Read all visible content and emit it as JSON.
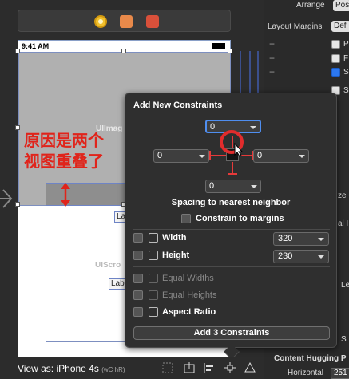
{
  "phone": {
    "status_time": "9:41 AM",
    "image_view_label": "UIImag",
    "scroll_view_label": "UIScro",
    "label1": "Lab",
    "label2": "Lab"
  },
  "annotation": {
    "line1": "原因是两个",
    "line2": "视图重叠了"
  },
  "inspector": {
    "arrange_label": "Arrange",
    "arrange_value": "Pos",
    "layout_margins_label": "Layout Margins",
    "layout_margins_value": "Def",
    "row_p": "P",
    "row_f": "F",
    "row_s": "S",
    "row_s2": "S",
    "side_ze": "ze C",
    "side_al": "al H",
    "side_le": "Le",
    "side_s": "S"
  },
  "popover": {
    "title": "Add New Constraints",
    "top_value": "0",
    "left_value": "0",
    "right_value": "0",
    "bottom_value": "0",
    "spacing_label": "Spacing to nearest neighbor",
    "constrain_margins": "Constrain to margins",
    "width_label": "Width",
    "width_value": "320",
    "height_label": "Height",
    "height_value": "230",
    "equal_widths": "Equal Widths",
    "equal_heights": "Equal Heights",
    "aspect_ratio": "Aspect Ratio",
    "add_button": "Add 3 Constraints"
  },
  "bottom_bar": {
    "view_as": "View as: iPhone 4s",
    "size_class": "(wC hR)"
  },
  "footer": {
    "content_hugging": "Content Hugging P",
    "horizontal_label": "Horizontal",
    "horizontal_value": "251"
  },
  "colors": {
    "annotation_red": "#e0241b",
    "accent_blue": "#4f8ef0",
    "strut_red": "#e63a3a"
  }
}
